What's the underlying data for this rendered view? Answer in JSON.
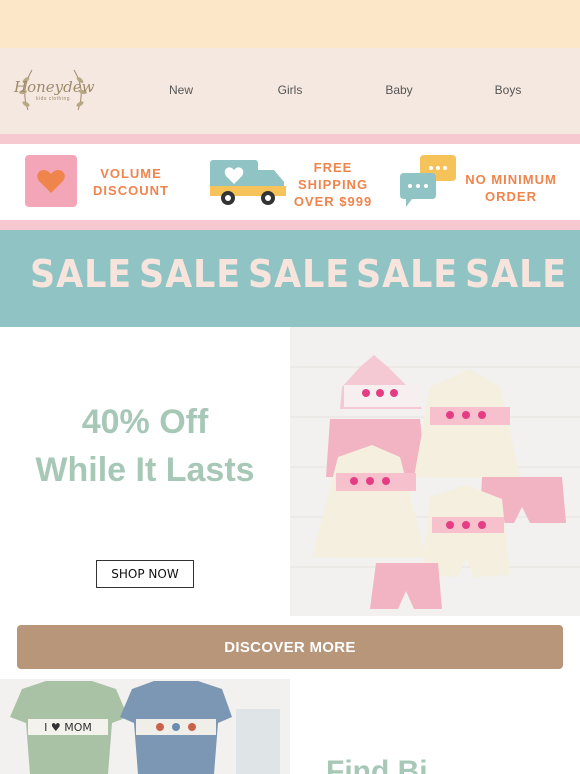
{
  "brand": {
    "name": "Honeydew",
    "tagline": "kids clothing"
  },
  "nav": {
    "items": [
      {
        "label": "New"
      },
      {
        "label": "Girls"
      },
      {
        "label": "Baby"
      },
      {
        "label": "Boys"
      }
    ]
  },
  "features": {
    "volume": {
      "line1": "VOLUME",
      "line2": "DISCOUNT"
    },
    "shipping": {
      "line1": "FREE",
      "line2": "SHIPPING",
      "line3": "OVER $999"
    },
    "minimum": {
      "line1": "NO MINIMUM",
      "line2": "ORDER"
    }
  },
  "sale": {
    "words": [
      "SALE",
      "SALE",
      "SALE",
      "SALE",
      "SALE"
    ]
  },
  "promo": {
    "line1": "40% Off",
    "line2": "While It Lasts",
    "shop_label": "SHOP NOW",
    "discover_label": "DISCOVER MORE"
  },
  "next": {
    "teaser": "Find Bi"
  },
  "product": {
    "tee_text": "I ♥ MOM"
  },
  "colors": {
    "topbar": "#fde7c9",
    "nav_bg": "#f5e8e1",
    "accent_orange": "#f0844d",
    "teal": "#90c3c3",
    "sage": "#a7c8b6",
    "tan": "#b8967a",
    "pink": "#f6c8cf"
  }
}
